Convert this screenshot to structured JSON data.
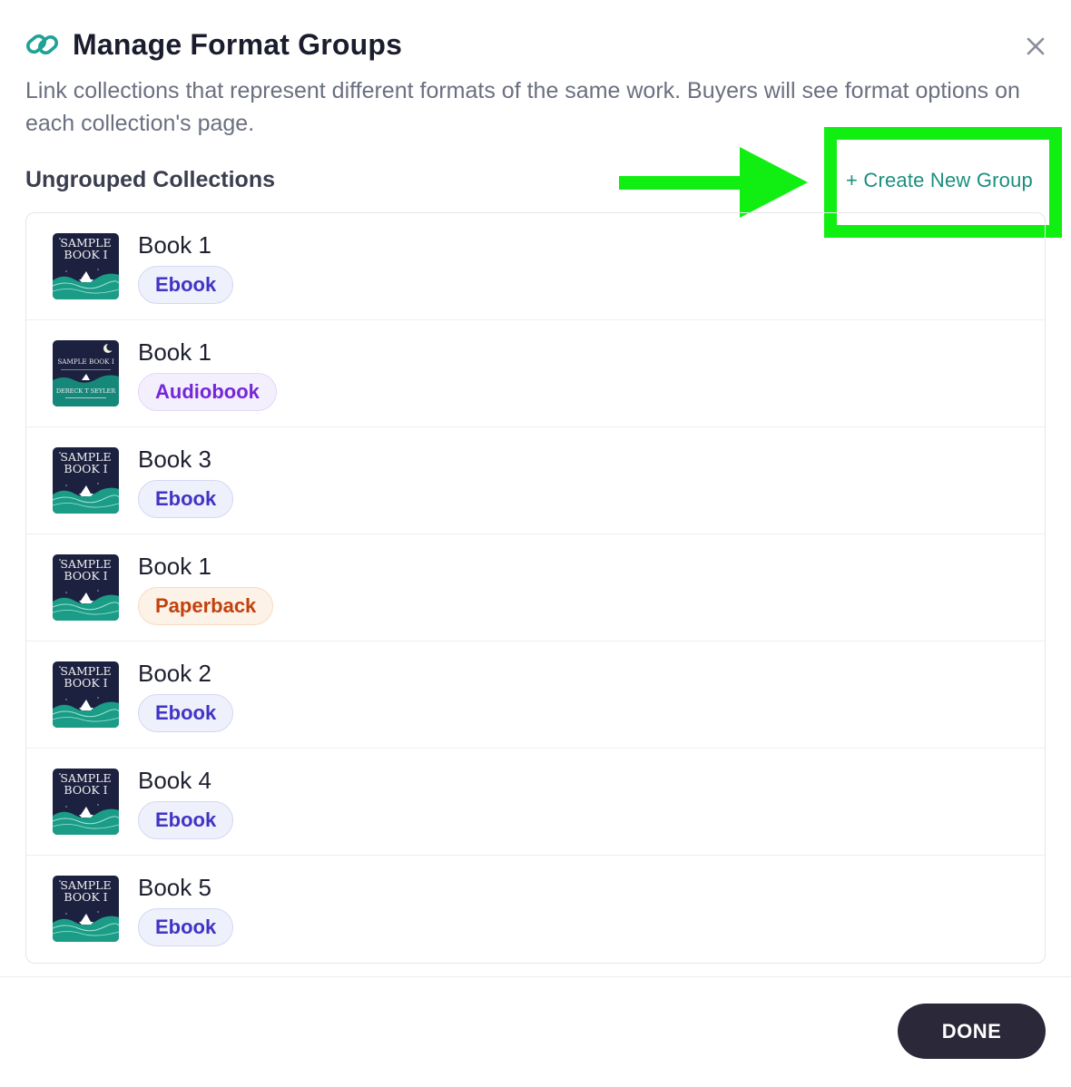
{
  "modal": {
    "title": "Manage Format Groups",
    "subtitle": "Link collections that represent different formats of the same work. Buyers will see format options on each collection's page.",
    "icons": {
      "header": "link-icon",
      "close": "close-icon",
      "annotation": "arrow-right-icon"
    }
  },
  "section": {
    "heading": "Ungrouped Collections",
    "create_label": "+ Create New Group"
  },
  "cover_text": {
    "sample_line1": "SAMPLE",
    "sample_line2": "BOOK I",
    "audio_title": "SAMPLE BOOK I",
    "audio_author": "DERECK T SEYLER"
  },
  "collections": [
    {
      "title": "Book 1",
      "format": "Ebook",
      "format_kind": "ebook",
      "cover": "ebook-cover"
    },
    {
      "title": "Book 1",
      "format": "Audiobook",
      "format_kind": "audiobook",
      "cover": "audiobook-cover"
    },
    {
      "title": "Book 3",
      "format": "Ebook",
      "format_kind": "ebook",
      "cover": "ebook-cover"
    },
    {
      "title": "Book 1",
      "format": "Paperback",
      "format_kind": "paperback",
      "cover": "ebook-cover"
    },
    {
      "title": "Book 2",
      "format": "Ebook",
      "format_kind": "ebook",
      "cover": "ebook-cover"
    },
    {
      "title": "Book 4",
      "format": "Ebook",
      "format_kind": "ebook",
      "cover": "ebook-cover"
    },
    {
      "title": "Book 5",
      "format": "Ebook",
      "format_kind": "ebook",
      "cover": "ebook-cover"
    }
  ],
  "footer": {
    "done_label": "DONE"
  },
  "colors": {
    "accent_teal": "#1a8f7e",
    "highlight_green": "#11ee11",
    "done_bg": "#2a2839",
    "ebook_text": "#4133c4",
    "audiobook_text": "#7427d8",
    "paperback_text": "#c2410c"
  }
}
